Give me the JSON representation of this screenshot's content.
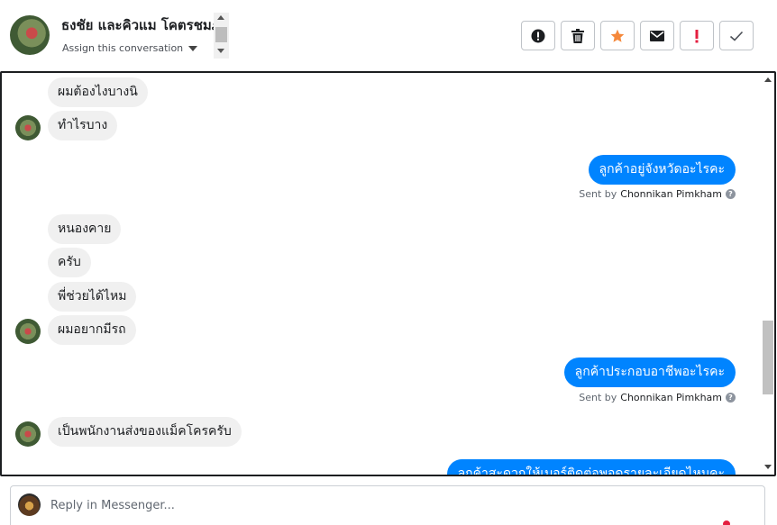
{
  "header": {
    "contact_name": "ธงชัย และคิวแม โคตรชมภู",
    "assign_label": "Assign this conversation"
  },
  "actions": [
    {
      "name": "alert",
      "icon": "alert-circle-icon"
    },
    {
      "name": "delete",
      "icon": "trash-icon"
    },
    {
      "name": "star",
      "icon": "star-icon"
    },
    {
      "name": "mail",
      "icon": "envelope-icon"
    },
    {
      "name": "important",
      "icon": "exclamation-icon"
    },
    {
      "name": "done",
      "icon": "checkmark-icon"
    }
  ],
  "colors": {
    "outgoing_bubble": "#0084ff",
    "incoming_bubble": "#f0f0f0",
    "star": "#f5883b",
    "important": "#e41e3f"
  },
  "messages": {
    "m1": "ผมต้องไงบางนิ",
    "m2": "ทำไรบาง",
    "m3": "ลูกค้าอยู่จังหวัดอะไรคะ",
    "m4": "หนองคาย",
    "m5": "ครับ",
    "m6": "พี่ช่วยได้ไหม",
    "m7": "ผมอยากมีรถ",
    "m8": "ลูกค้าประกอบอาชีพอะไรคะ",
    "m9": "เป็นพนักงานส่งของแม็คโครครับ",
    "m10": "ลูกค้าสะดวกให้เบอร์ติดต่อพอดูรายละเอียดไหมคะ"
  },
  "sent_by": {
    "prefix": "Sent by",
    "agent": "Chonnikan Pimkham",
    "help": "?"
  },
  "reply": {
    "placeholder": "Reply in Messenger..."
  }
}
